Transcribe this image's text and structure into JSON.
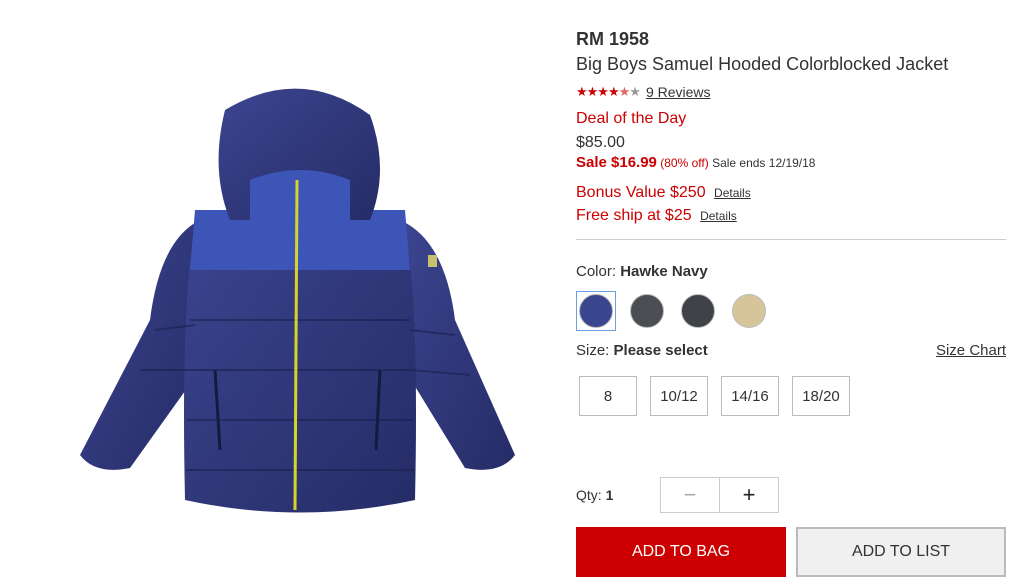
{
  "product": {
    "price_rm": "RM 1958",
    "title": "Big Boys Samuel Hooded Colorblocked Jacket",
    "rating_stars": 4.5,
    "reviews_label": "9 Reviews",
    "deal_label": "Deal of the Day",
    "original_price": "$85.00",
    "sale_price": "Sale $16.99",
    "discount": "(80% off)",
    "sale_ends": "Sale ends 12/19/18",
    "bonus": "Bonus Value $250",
    "free_ship": "Free ship at $25",
    "details_label": "Details"
  },
  "color": {
    "label": "Color:",
    "selected": "Hawke Navy",
    "swatches": [
      {
        "name": "hawke-navy",
        "color": "#3a4690"
      },
      {
        "name": "charcoal",
        "color": "#4a4d52"
      },
      {
        "name": "dark-grey",
        "color": "#3f4347"
      },
      {
        "name": "khaki",
        "color": "#d6c49a"
      }
    ]
  },
  "size": {
    "label": "Size:",
    "selected": "Please select",
    "chart_label": "Size Chart",
    "options": [
      "8",
      "10/12",
      "14/16",
      "18/20"
    ]
  },
  "qty": {
    "label": "Qty:",
    "value": "1",
    "minus": "−",
    "plus": "+"
  },
  "buttons": {
    "add_to_bag": "ADD TO BAG",
    "add_to_list": "ADD TO LIST"
  }
}
